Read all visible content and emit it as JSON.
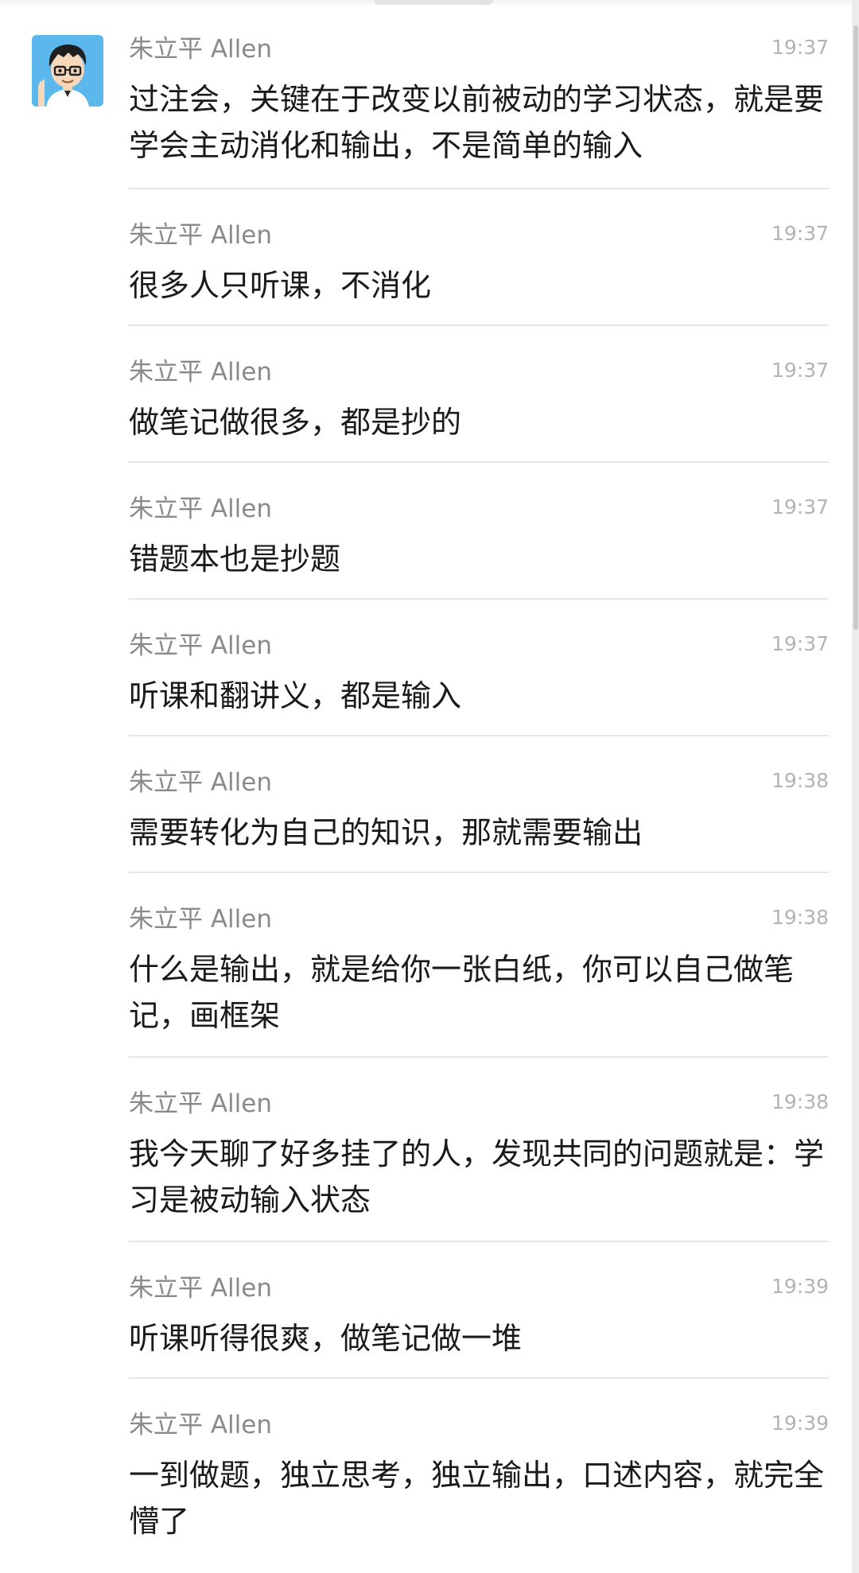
{
  "sender": "朱立平 Allen",
  "messages": [
    {
      "time": "19:37",
      "text": "过注会，关键在于改变以前被动的学习状态，就是要学会主动消化和输出，不是简单的输入"
    },
    {
      "time": "19:37",
      "text": "很多人只听课，不消化"
    },
    {
      "time": "19:37",
      "text": "做笔记做很多，都是抄的"
    },
    {
      "time": "19:37",
      "text": "错题本也是抄题"
    },
    {
      "time": "19:37",
      "text": "听课和翻讲义，都是输入"
    },
    {
      "time": "19:38",
      "text": "需要转化为自己的知识，那就需要输出"
    },
    {
      "time": "19:38",
      "text": "什么是输出，就是给你一张白纸，你可以自己做笔记，画框架"
    },
    {
      "time": "19:38",
      "text": "我今天聊了好多挂了的人，发现共同的问题就是：学习是被动输入状态"
    },
    {
      "time": "19:39",
      "text": "听课听得很爽，做笔记做一堆"
    },
    {
      "time": "19:39",
      "text": "一到做题，独立思考，独立输出，口述内容，就完全懵了"
    }
  ],
  "colors": {
    "name": "#8a8a8a",
    "time": "#b3b3b3",
    "text": "#1a1a1a",
    "divider": "#e6e6e6",
    "avatar_bg": "#5cb8ec"
  },
  "icons": {
    "avatar": "cartoon-boy-glasses-avatar"
  }
}
